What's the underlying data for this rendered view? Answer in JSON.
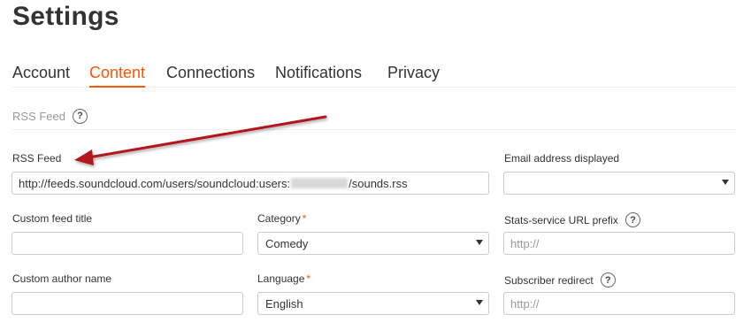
{
  "page": {
    "title": "Settings"
  },
  "tabs": [
    "Account",
    "Content",
    "Connections",
    "Notifications",
    "Privacy"
  ],
  "active_tab": "Content",
  "section": {
    "label": "RSS Feed",
    "help": "?"
  },
  "fields": {
    "rss_feed": {
      "label": "RSS Feed",
      "value_prefix": "http://feeds.soundcloud.com/users/soundcloud:users:",
      "value_suffix": "/sounds.rss"
    },
    "email_displayed": {
      "label": "Email address displayed",
      "value": ""
    },
    "custom_feed_title": {
      "label": "Custom feed title",
      "value": ""
    },
    "category": {
      "label": "Category",
      "required_mark": "*",
      "value": "Comedy"
    },
    "stats_prefix": {
      "label": "Stats-service URL prefix",
      "help": "?",
      "placeholder": "http://"
    },
    "custom_author": {
      "label": "Custom author name",
      "value": ""
    },
    "language": {
      "label": "Language",
      "required_mark": "*",
      "value": "English"
    },
    "subscriber_redirect": {
      "label": "Subscriber redirect",
      "help": "?",
      "placeholder": "http://"
    }
  },
  "colors": {
    "accent": "#ff5500",
    "annotation_arrow": "#b3151b",
    "text": "#333333",
    "muted": "#999999",
    "border": "#cccccc"
  },
  "annotation": {
    "icon": "red-arrow-icon"
  }
}
